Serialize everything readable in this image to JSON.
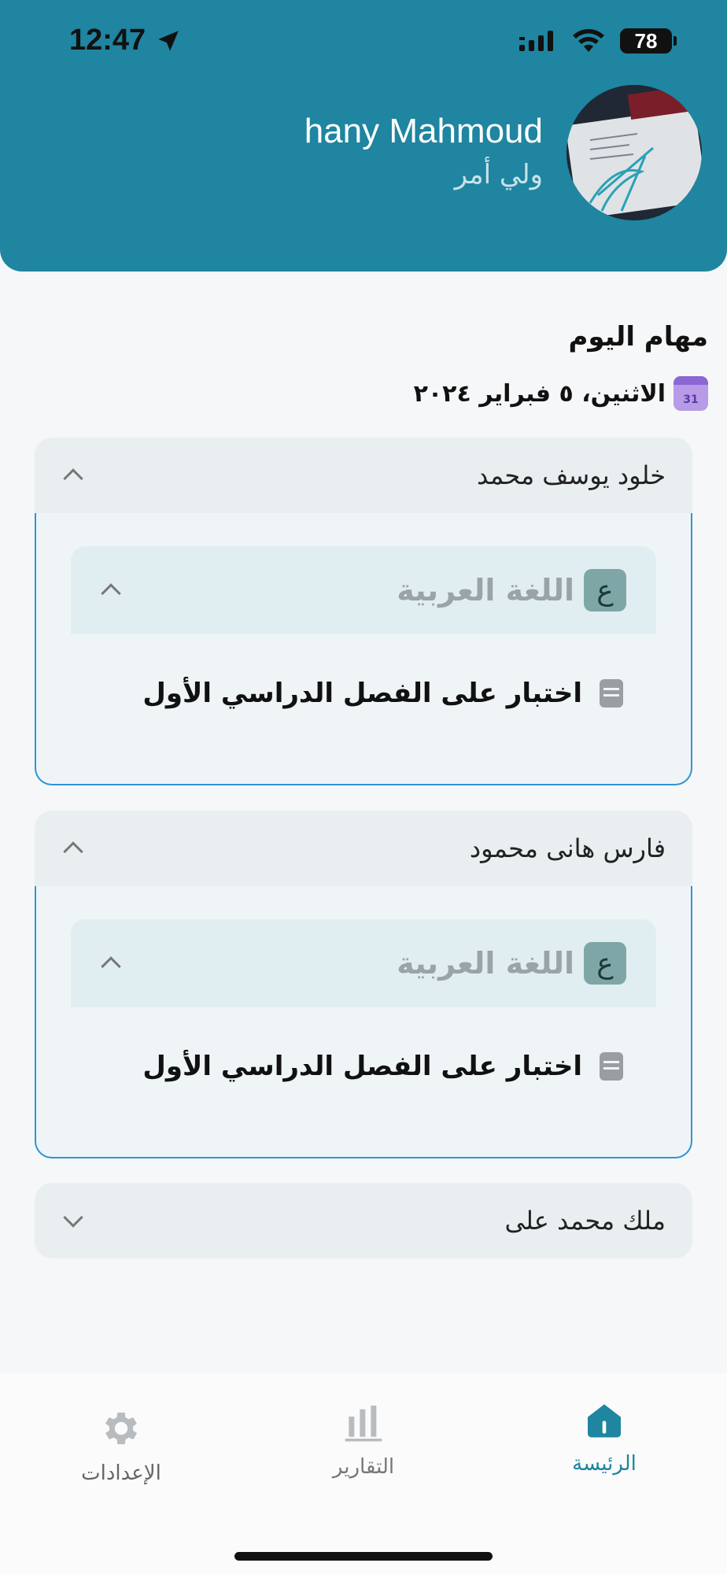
{
  "status_bar": {
    "time": "12:47",
    "battery": "78"
  },
  "header": {
    "name": "hany Mahmoud",
    "role": "ولي أمر"
  },
  "today": {
    "title": "مهام اليوم",
    "date": "الاثنين، ٥ فبراير ٢٠٢٤",
    "calendar_day": "31"
  },
  "students": [
    {
      "name": "خلود يوسف محمد",
      "expanded": true,
      "subject": {
        "badge": "ع",
        "name": "اللغة العربية"
      },
      "task": "اختبار على الفصل الدراسي الأول"
    },
    {
      "name": "فارس هانى محمود",
      "expanded": true,
      "subject": {
        "badge": "ع",
        "name": "اللغة العربية"
      },
      "task": "اختبار على الفصل الدراسي الأول"
    },
    {
      "name": "ملك محمد على",
      "expanded": false
    }
  ],
  "nav": {
    "settings": "الإعدادات",
    "reports": "التقارير",
    "home": "الرئيسة",
    "active": "home",
    "accent": "#1f85a0"
  }
}
